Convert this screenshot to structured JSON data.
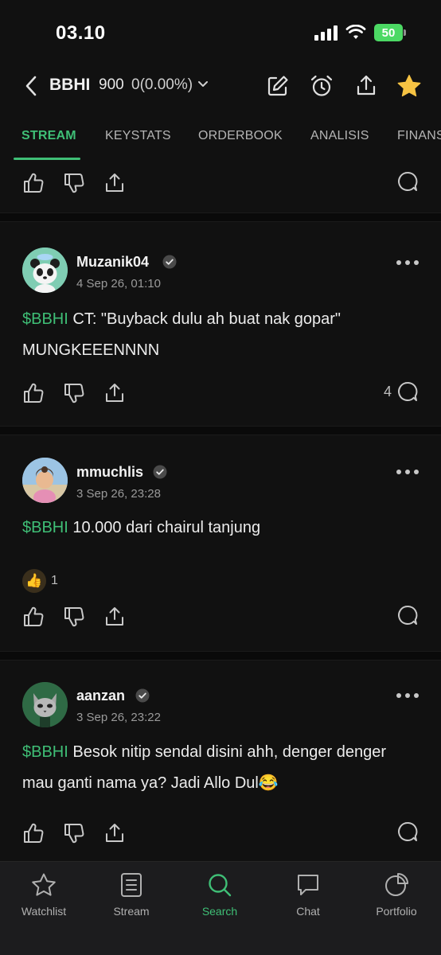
{
  "status_bar": {
    "time": "03.10",
    "battery": "50"
  },
  "header": {
    "ticker": "BBHI",
    "price": "900",
    "change": "0(0.00%)"
  },
  "tabs": [
    "STREAM",
    "KEYSTATS",
    "ORDERBOOK",
    "ANALISIS",
    "FINANSIAL"
  ],
  "posts": [
    {
      "username": "Muzanik04",
      "timestamp": "4 Sep 26, 01:10",
      "cashtag": "$BBHI",
      "text": " CT: \"Buyback dulu ah buat nak gopar\" MUNGKEEENNNN",
      "comments": "4"
    },
    {
      "username": "mmuchlis",
      "timestamp": "3 Sep 26, 23:28",
      "cashtag": "$BBHI",
      "text": " 10.000 dari chairul tanjung",
      "reaction_emoji": "👍",
      "reaction_count": "1"
    },
    {
      "username": "aanzan",
      "timestamp": "3 Sep 26, 23:22",
      "cashtag": "$BBHI",
      "text": " Besok nitip sendal disini ahh, denger denger mau ganti nama ya? Jadi Allo Dul😂"
    }
  ],
  "nav": [
    "Watchlist",
    "Stream",
    "Search",
    "Chat",
    "Portfolio"
  ],
  "colors": {
    "accent": "#3fbf76",
    "background": "#111111",
    "star": "#f6c343"
  }
}
